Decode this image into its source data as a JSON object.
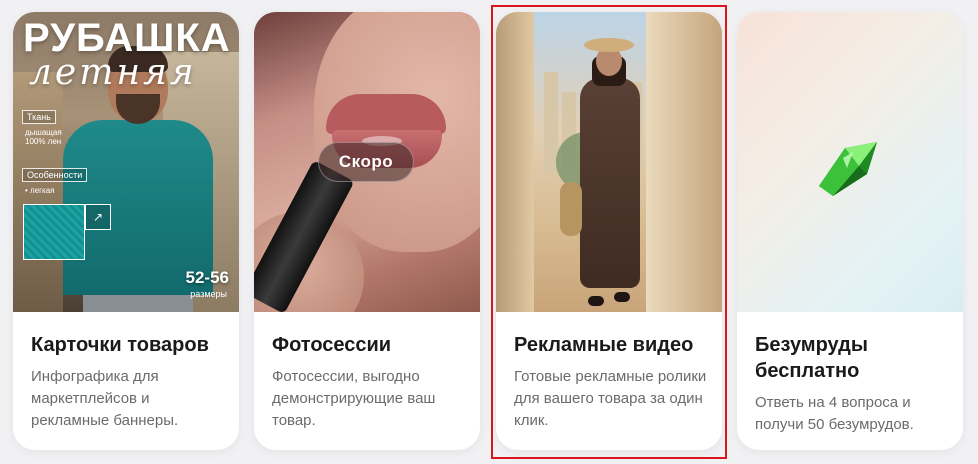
{
  "cards": [
    {
      "title": "Карточки товаров",
      "description": "Инфографика для маркетплейсов и рекламные баннеры.",
      "image": {
        "headline": "РУБАШКА",
        "script_headline": "летняя",
        "tag_fabric": "Ткань",
        "tag_fabric_sub": "дышащая\n100% лен",
        "tag_features": "Особенности",
        "tag_features_sub": "• легкая",
        "size_value": "52-56",
        "size_label": "размеры",
        "zoom_icon": "arrow-up-right-icon"
      }
    },
    {
      "title": "Фотосессии",
      "description": "Фотосессии, выгодно демонстрирующие ваш товар.",
      "badge": "Скоро"
    },
    {
      "title": "Рекламные видео",
      "description": "Готовые рекламные ролики для вашего товара за один клик.",
      "selected": true
    },
    {
      "title": "Безумруды бесплатно",
      "description": "Ответь на 4 вопроса и получи 50 безумрудов.",
      "icon": "emerald-gem-icon"
    }
  ],
  "colors": {
    "selection_border": "#d9161d",
    "title": "#1a1a1a",
    "description": "#6b6b6b",
    "gem": "#3cc23a"
  }
}
